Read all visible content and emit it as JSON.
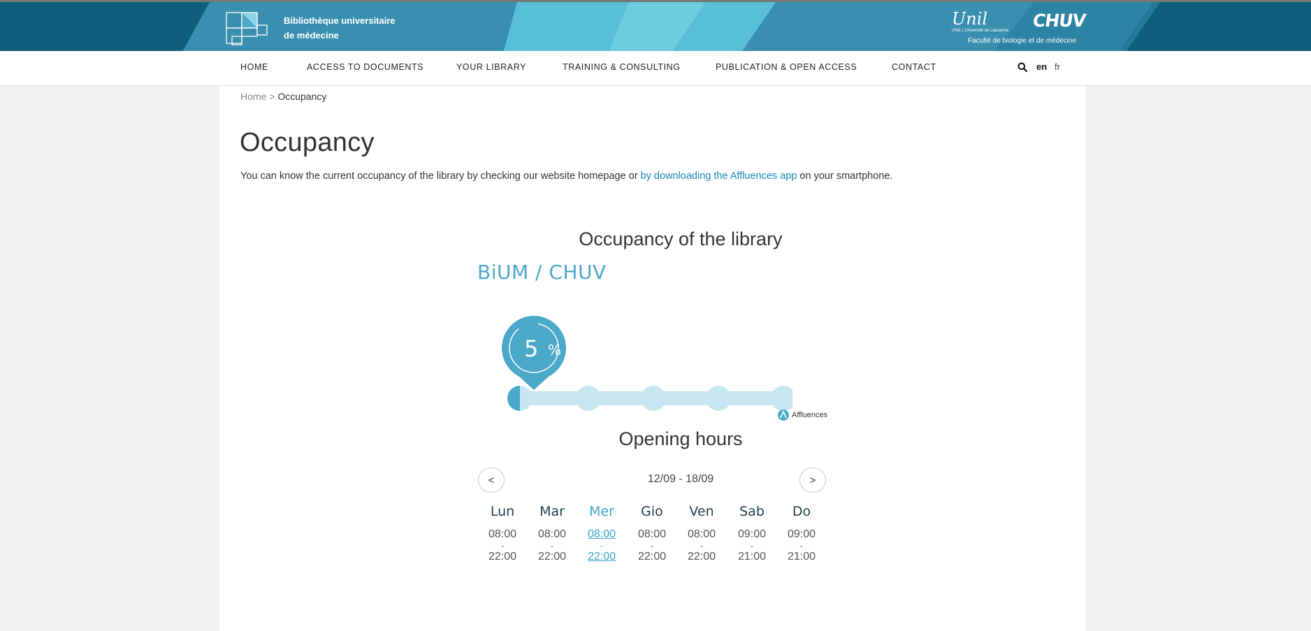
{
  "header": {
    "site_name_line1": "Bibliothèque universitaire",
    "site_name_line2": "de médecine",
    "unil": "Unil",
    "unil_sub": "UNIL | Université de Lausanne",
    "chuv": "CHUV",
    "faculty": "Faculté de biologie et de médecine"
  },
  "nav": {
    "items": [
      {
        "label": "HOME"
      },
      {
        "label": "ACCESS TO DOCUMENTS"
      },
      {
        "label": "YOUR LIBRARY"
      },
      {
        "label": "TRAINING & CONSULTING"
      },
      {
        "label": "PUBLICATION & OPEN ACCESS"
      },
      {
        "label": "CONTACT"
      }
    ],
    "lang_en": "en",
    "lang_fr": "fr"
  },
  "breadcrumb": {
    "home": "Home",
    "sep": " > ",
    "current": "Occupancy"
  },
  "page": {
    "title": "Occupancy",
    "intro_before": "You can know the current occupancy of the library by checking our website homepage or ",
    "intro_link": "by downloading the Affluences app",
    "intro_after": " on your smartphone."
  },
  "occupancy": {
    "title": "Occupancy of the library",
    "location": "BiUM / CHUV",
    "value": "5",
    "unit": "%",
    "percent": 5,
    "brand": "Affluences",
    "colors": {
      "accent": "#4aa9c9",
      "track": "#c7e6ef"
    }
  },
  "hours": {
    "title": "Opening hours",
    "prev": "<",
    "next": ">",
    "range": "12/09 - 18/09",
    "days": [
      {
        "name": "Lun",
        "open": "08:00",
        "sep": "-",
        "close": "22:00"
      },
      {
        "name": "Mar",
        "open": "08:00",
        "sep": "-",
        "close": "22:00"
      },
      {
        "name": "Mer",
        "open": "08:00",
        "sep": "-",
        "close": "22:00"
      },
      {
        "name": "Gio",
        "open": "08:00",
        "sep": "-",
        "close": "22:00"
      },
      {
        "name": "Ven",
        "open": "08:00",
        "sep": "-",
        "close": "22:00"
      },
      {
        "name": "Sab",
        "open": "09:00",
        "sep": "-",
        "close": "21:00"
      },
      {
        "name": "Do",
        "open": "09:00",
        "sep": "-",
        "close": "21:00"
      }
    ]
  }
}
